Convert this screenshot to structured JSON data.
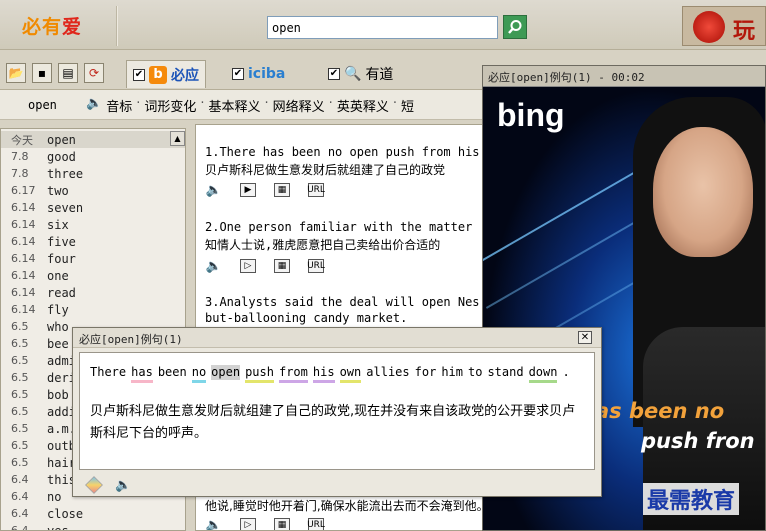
{
  "app": {
    "logo_main": "必有",
    "logo_accent": "爱",
    "search": {
      "value": "open"
    },
    "ad_text": "玩"
  },
  "tabs": [
    {
      "label": "必应",
      "badge": "b",
      "checked": true
    },
    {
      "label": "iciba",
      "checked": true
    },
    {
      "label": "有道",
      "checked": true
    }
  ],
  "subnav": {
    "word": "open",
    "items": [
      "音标",
      "词形变化",
      "基本释义",
      "网络释义",
      "英英释义",
      "短"
    ]
  },
  "wordlist": [
    {
      "date": "今天",
      "word": "open"
    },
    {
      "date": "7.8",
      "word": "good"
    },
    {
      "date": "7.8",
      "word": "three"
    },
    {
      "date": "6.17",
      "word": "two"
    },
    {
      "date": "6.14",
      "word": "seven"
    },
    {
      "date": "6.14",
      "word": "six"
    },
    {
      "date": "6.14",
      "word": "five"
    },
    {
      "date": "6.14",
      "word": "four"
    },
    {
      "date": "6.14",
      "word": "one"
    },
    {
      "date": "6.14",
      "word": "read"
    },
    {
      "date": "6.14",
      "word": "fly"
    },
    {
      "date": "6.5",
      "word": "who"
    },
    {
      "date": "6.5",
      "word": "bee"
    },
    {
      "date": "6.5",
      "word": "admi"
    },
    {
      "date": "6.5",
      "word": "deri"
    },
    {
      "date": "6.5",
      "word": "bob"
    },
    {
      "date": "6.5",
      "word": "addi"
    },
    {
      "date": "6.5",
      "word": "a.m."
    },
    {
      "date": "6.5",
      "word": "outb"
    },
    {
      "date": "6.5",
      "word": "hair"
    },
    {
      "date": "6.4",
      "word": "this"
    },
    {
      "date": "6.4",
      "word": "no"
    },
    {
      "date": "6.4",
      "word": "close"
    },
    {
      "date": "6.4",
      "word": "yes"
    }
  ],
  "examples": [
    {
      "en": "1.There has been no open push from his",
      "zh": "贝卢斯科尼做生意发财后就组建了自己的政党"
    },
    {
      "en": "2.One person familiar with the matter",
      "zh": "知情人士说,雅虎愿意把自己卖给出价合适的"
    },
    {
      "en": "3.Analysts said the deal will open Nes",
      "zh": "but-ballooning candy market."
    },
    {
      "en": "",
      "zh": "他说,睡觉时他开着门,确保水能流出去而不会淹到他。"
    }
  ],
  "example_icons": {
    "url": "URL"
  },
  "video": {
    "title": "必应[open]例句(1) - 00:02",
    "logo": "bing",
    "caption_line1": "as been no",
    "caption_line2": "push fron",
    "watermark": "最需教育"
  },
  "popup": {
    "title": "必应[open]例句(1)",
    "close": "✕",
    "en_words": [
      {
        "t": "There",
        "u": ""
      },
      {
        "t": "has",
        "u": "ul-pink"
      },
      {
        "t": "been",
        "u": ""
      },
      {
        "t": "no",
        "u": "ul-cyan"
      },
      {
        "t": "open",
        "u": "hl"
      },
      {
        "t": "push",
        "u": "ul-yellow"
      },
      {
        "t": "from",
        "u": "ul-purple"
      },
      {
        "t": "his",
        "u": "ul-purple"
      },
      {
        "t": "own",
        "u": "ul-yellow"
      },
      {
        "t": "allies",
        "u": ""
      },
      {
        "t": "for",
        "u": ""
      },
      {
        "t": "him",
        "u": ""
      },
      {
        "t": "to",
        "u": ""
      },
      {
        "t": "stand",
        "u": ""
      },
      {
        "t": "down",
        "u": "ul-green"
      },
      {
        "t": ".",
        "u": ""
      }
    ],
    "zh": "贝卢斯科尼做生意发财后就组建了自己的政党,现在并没有来自该政党的公开要求贝卢斯科尼下台的呼声。"
  }
}
